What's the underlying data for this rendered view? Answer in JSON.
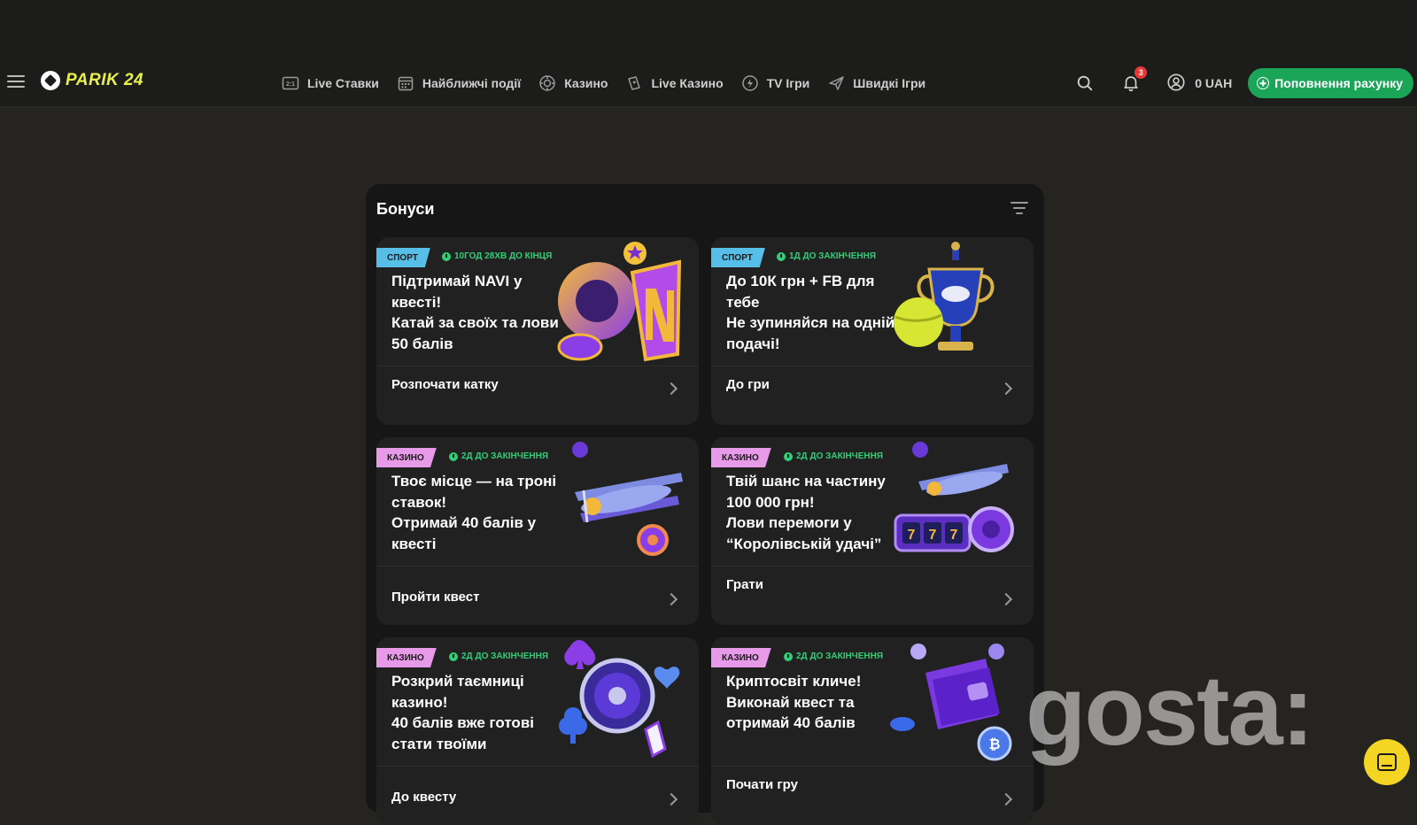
{
  "brand": {
    "logo_text": "PARIK 24"
  },
  "nav": [
    {
      "label": "Live Ставки",
      "icon": "live-bets-icon"
    },
    {
      "label": "Найближчі події",
      "icon": "calendar-icon"
    },
    {
      "label": "Казино",
      "icon": "casino-chip-icon"
    },
    {
      "label": "Live Казино",
      "icon": "live-casino-icon"
    },
    {
      "label": "TV Ігри",
      "icon": "tv-games-icon"
    },
    {
      "label": "Швидкі Ігри",
      "icon": "rocket-icon"
    }
  ],
  "header": {
    "notifications_count": "3",
    "balance": "0 UAH",
    "deposit_label": "Поповнення рахунку"
  },
  "bonuses": {
    "title": "Бонуси",
    "cards": [
      {
        "tag": "СПОРТ",
        "tag_type": "sport",
        "timer": "10ГОД 28ХВ ДО КІНЦЯ",
        "title": "Підтримай NAVI у квесті!\nКатай за своїх та лови 50 балів",
        "cta": "Розпочати катку",
        "art": "navi-logo-art"
      },
      {
        "tag": "СПОРТ",
        "tag_type": "sport",
        "timer": "1Д ДО ЗАКІНЧЕННЯ",
        "title": "До 10К грн + FB для тебе\nНе зупиняйся на одній подачі!",
        "cta": "До гри",
        "art": "us-open-trophy-art"
      },
      {
        "tag": "КАЗИНО",
        "tag_type": "casino",
        "timer": "2Д ДО ЗАКІНЧЕННЯ",
        "title": "Твоє місце — на троні ставок!\nОтримай 40 балів у квесті",
        "cta": "Пройти квест",
        "art": "airplane-art"
      },
      {
        "tag": "КАЗИНО",
        "tag_type": "casino",
        "timer": "2Д ДО ЗАКІНЧЕННЯ",
        "title": "Твій шанс на частину 100 000 грн!\nЛови перемоги у “Королівській удачі”",
        "cta": "Грати",
        "art": "airplane-slot-art"
      },
      {
        "tag": "КАЗИНО",
        "tag_type": "casino",
        "timer": "2Д ДО ЗАКІНЧЕННЯ",
        "title": "Розкрий таємниці казино!\n40 балів вже готові стати твоїми",
        "cta": "До квесту",
        "art": "roulette-cards-art"
      },
      {
        "tag": "КАЗИНО",
        "tag_type": "casino",
        "timer": "2Д ДО ЗАКІНЧЕННЯ",
        "title": "Криптосвіт кличе!\nВиконай квест та отримай 40 балів",
        "cta": "Почати гру",
        "art": "crypto-wallet-art"
      }
    ]
  },
  "watermark": "gosta:",
  "colors": {
    "accent_green": "#1aa559",
    "logo_yellow": "#e9f04c",
    "sport_tag": "#57bfe7",
    "casino_tag": "#e79ae8",
    "timer_green": "#2fcf78"
  }
}
